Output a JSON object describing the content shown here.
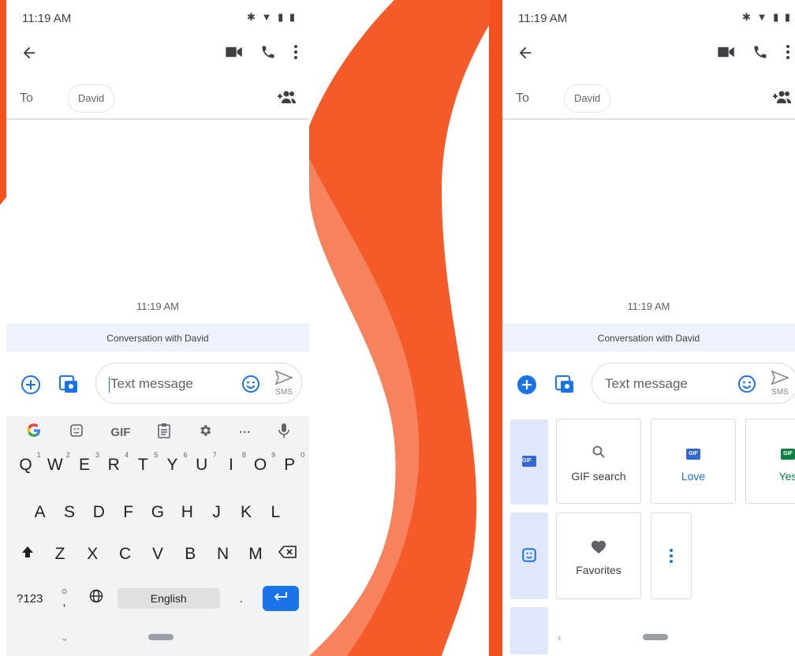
{
  "status": {
    "time": "11:19 AM"
  },
  "recipient": {
    "to_label": "To",
    "name": "David"
  },
  "thread": {
    "timestamp": "11:19 AM",
    "banner": "Conversation with David"
  },
  "composer": {
    "placeholder": "Text message",
    "send_label": "SMS"
  },
  "keyboard": {
    "tools": [
      "G",
      "sticker",
      "GIF",
      "clipboard",
      "settings",
      "more",
      "mic"
    ],
    "row1": [
      {
        "k": "Q",
        "h": "1"
      },
      {
        "k": "W",
        "h": "2"
      },
      {
        "k": "E",
        "h": "3"
      },
      {
        "k": "R",
        "h": "4"
      },
      {
        "k": "T",
        "h": "5"
      },
      {
        "k": "Y",
        "h": "6"
      },
      {
        "k": "U",
        "h": "7"
      },
      {
        "k": "I",
        "h": "8"
      },
      {
        "k": "O",
        "h": "9"
      },
      {
        "k": "P",
        "h": "0"
      }
    ],
    "row2": [
      "A",
      "S",
      "D",
      "F",
      "G",
      "H",
      "J",
      "K",
      "L"
    ],
    "row3": [
      "Z",
      "X",
      "C",
      "V",
      "B",
      "N",
      "M"
    ],
    "sym_label": "?123",
    "comma": ",",
    "space_label": "English",
    "period": "."
  },
  "gif_panel": {
    "tiles_row1": [
      {
        "icon": "search-icon",
        "label": "GIF search"
      },
      {
        "icon": "gif-badge",
        "label": "Love"
      },
      {
        "icon": "gif-badge",
        "label": "Yes"
      }
    ],
    "tiles_row2": [
      {
        "icon": "heart-icon",
        "label": "Favorites"
      }
    ],
    "gif_badge_text": "GIF"
  },
  "colors": {
    "accent": "#1a73e8",
    "swoosh": "#f4511e",
    "banner_bg": "#eef3fb",
    "keyboard_bg": "#f1f3f4"
  }
}
